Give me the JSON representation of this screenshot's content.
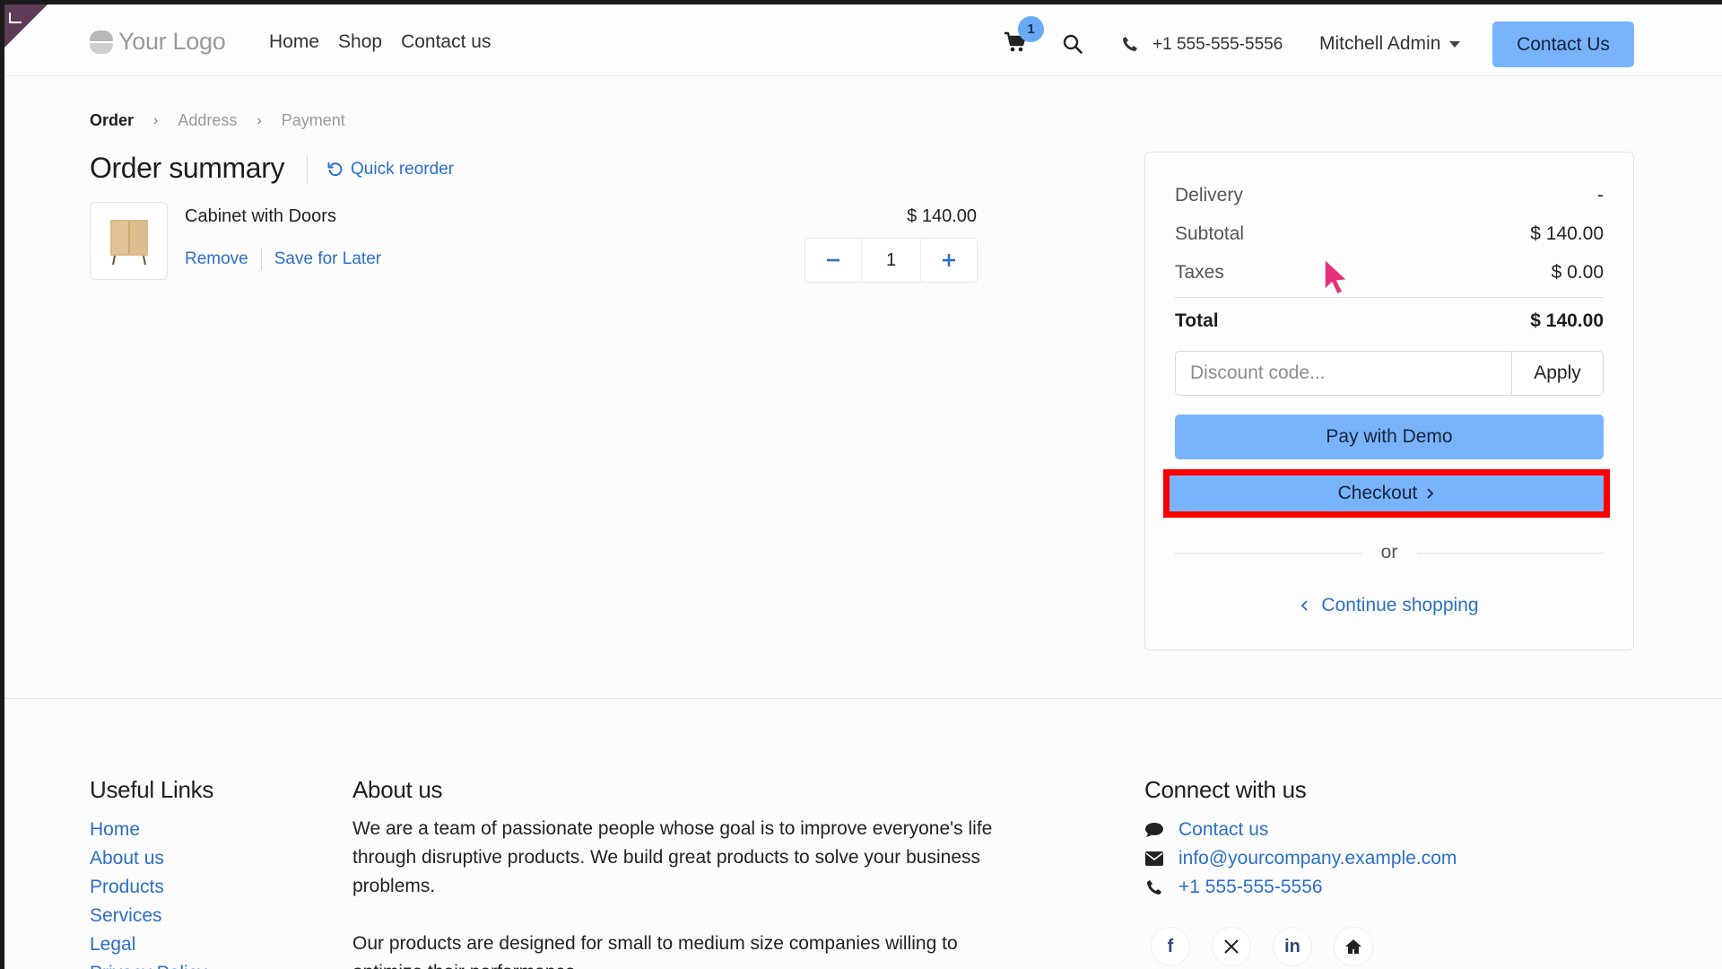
{
  "header": {
    "logo_text": "Your Logo",
    "nav": [
      "Home",
      "Shop",
      "Contact us"
    ],
    "cart_count": "1",
    "phone": "+1 555-555-5556",
    "user": "Mitchell Admin",
    "contact_button": "Contact Us"
  },
  "breadcrumb": {
    "steps": [
      "Order",
      "Address",
      "Payment"
    ]
  },
  "order": {
    "title": "Order summary",
    "quick_reorder": "Quick reorder",
    "line": {
      "name": "Cabinet with Doors",
      "price": "$ 140.00",
      "remove": "Remove",
      "save_later": "Save for Later",
      "quantity": "1"
    }
  },
  "summary": {
    "delivery_label": "Delivery",
    "delivery_value": "-",
    "subtotal_label": "Subtotal",
    "subtotal_value": "$ 140.00",
    "taxes_label": "Taxes",
    "taxes_value": "$ 0.00",
    "total_label": "Total",
    "total_value": "$ 140.00",
    "discount_placeholder": "Discount code...",
    "apply": "Apply",
    "pay_demo": "Pay with Demo",
    "checkout": "Checkout",
    "or": "or",
    "continue": "Continue shopping"
  },
  "footer": {
    "useful_title": "Useful Links",
    "useful_links": [
      "Home",
      "About us",
      "Products",
      "Services",
      "Legal",
      "Privacy Policy"
    ],
    "about_title": "About us",
    "about_p1": "We are a team of passionate people whose goal is to improve everyone's life through disruptive products. We build great products to solve your business problems.",
    "about_p2": "Our products are designed for small to medium size companies willing to optimize their performance.",
    "connect_title": "Connect with us",
    "connect_contact": "Contact us",
    "connect_email": "info@yourcompany.example.com",
    "connect_phone": "+1 555-555-5556"
  },
  "colors": {
    "primary_button": "#79b3fb",
    "link": "#2a6fc9",
    "highlight": "#ff0000"
  },
  "icons": {
    "cart": "cart-icon",
    "search": "search-icon",
    "phone": "phone-icon",
    "reorder": "reload-icon",
    "chevron": "chevron-right-icon",
    "social": [
      "facebook-icon",
      "x-icon",
      "linkedin-icon",
      "home-icon"
    ]
  }
}
